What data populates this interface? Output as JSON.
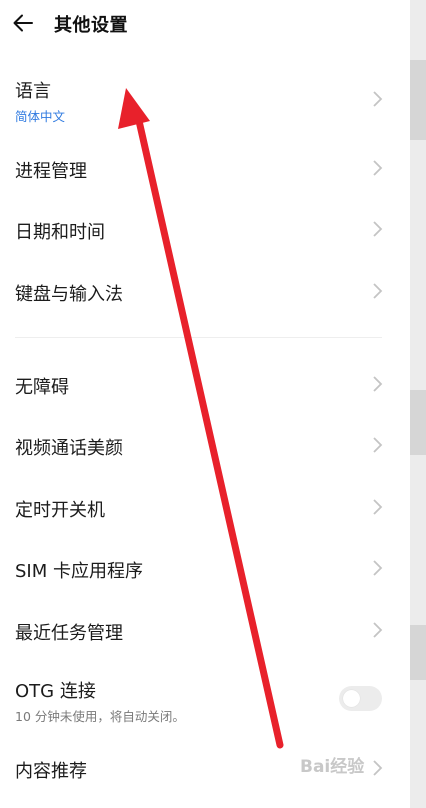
{
  "header": {
    "title": "其他设置",
    "back_icon": "back-arrow-icon"
  },
  "rows": [
    {
      "label": "语言",
      "sub": "简体中文"
    },
    {
      "label": "进程管理"
    },
    {
      "label": "日期和时间"
    },
    {
      "label": "键盘与输入法"
    },
    {
      "label": "无障碍"
    },
    {
      "label": "视频通话美颜"
    },
    {
      "label": "定时开关机"
    },
    {
      "label": "SIM 卡应用程序"
    },
    {
      "label": "最近任务管理"
    },
    {
      "label": "OTG 连接",
      "sub": "10 分钟未使用，将自动关闭。",
      "toggle_on": false
    },
    {
      "label": "内容推荐"
    }
  ],
  "watermark": "Bai经验",
  "colors": {
    "accent": "#2f7ae0",
    "annotation_arrow": "#e8212b"
  }
}
